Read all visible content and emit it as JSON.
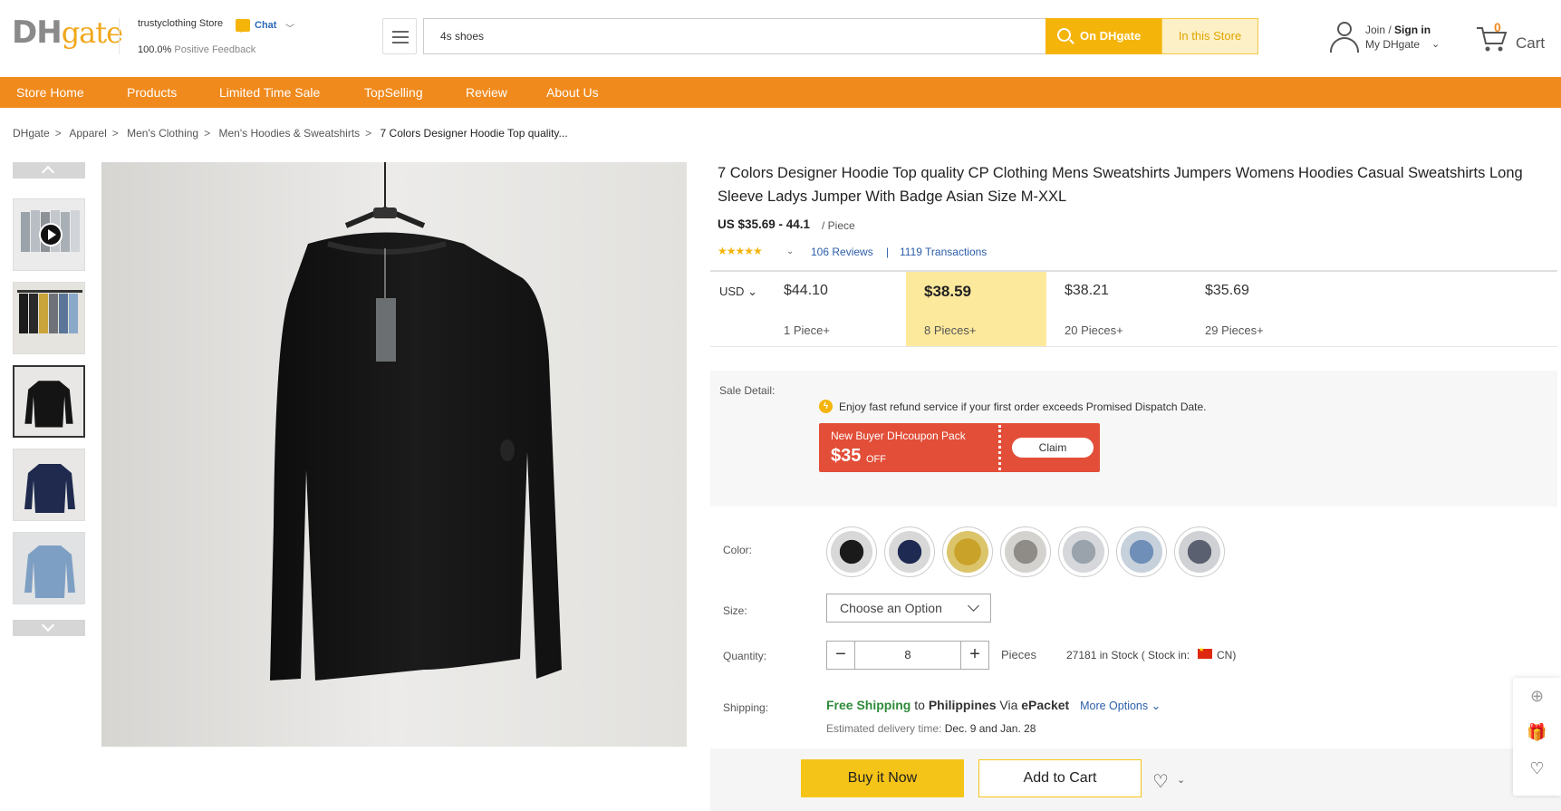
{
  "header": {
    "logo_main": "DH",
    "logo_sub": "gate",
    "store_name": "trustyclothing Store",
    "chat_label": "Chat",
    "feedback_pct": "100.0%",
    "feedback_label": "Positive Feedback",
    "search_value": "4s shoes",
    "search_on_label": "On DHgate",
    "search_store_label": "In this Store",
    "join_label": "Join",
    "signin_label": "Sign in",
    "my_dhgate_label": "My DHgate",
    "cart_count": "0",
    "cart_label": "Cart"
  },
  "nav": {
    "items": [
      "Store Home",
      "Products",
      "Limited Time Sale",
      "TopSelling",
      "Review",
      "About Us"
    ]
  },
  "breadcrumb": [
    "DHgate",
    "Apparel",
    "Men's Clothing",
    "Men's Hoodies & Sweatshirts",
    "7 Colors Designer Hoodie Top quality..."
  ],
  "product": {
    "title": "7 Colors Designer Hoodie Top quality CP Clothing Mens Sweatshirts Jumpers Womens Hoodies Casual Sweatshirts Long Sleeve Ladys Jumper With Badge Asian Size M-XXL",
    "price_range": "US $35.69 - 44.1",
    "price_unit": "/ Piece",
    "rating_stars": "★★★★★",
    "reviews_count": "106",
    "reviews_label": "Reviews",
    "transactions_count": "1119",
    "transactions_label": "Transactions",
    "currency": "USD",
    "tiers": [
      {
        "price": "$44.10",
        "qty": "1 Piece+"
      },
      {
        "price": "$38.59",
        "qty": "8 Pieces+"
      },
      {
        "price": "$38.21",
        "qty": "20 Pieces+"
      },
      {
        "price": "$35.69",
        "qty": "29 Pieces+"
      }
    ],
    "sale_label": "Sale Detail:",
    "refund_text": "Enjoy fast refund service if your first order exceeds Promised Dispatch Date.",
    "coupon": {
      "title": "New Buyer DHcoupon Pack",
      "amount": "$35",
      "off": "OFF",
      "claim": "Claim"
    },
    "color_label": "Color:",
    "size_label": "Size:",
    "size_placeholder": "Choose an Option",
    "quantity_label": "Quantity:",
    "quantity_value": "8",
    "quantity_unit": "Pieces",
    "stock_text": "27181  in Stock ( Stock in:",
    "stock_country": "CN)",
    "shipping_label": "Shipping:",
    "shipping_free": "Free Shipping",
    "shipping_to": "to",
    "shipping_country": "Philippines",
    "shipping_via": "Via",
    "shipping_method": "ePacket",
    "more_options": "More Options",
    "est_label": "Estimated delivery time:",
    "est_dates": "Dec. 9 and Jan. 28",
    "buy_now": "Buy it Now",
    "add_to_cart": "Add to Cart"
  },
  "colors": {
    "brand_orange": "#f08a1c",
    "brand_yellow": "#f5b40a",
    "coupon_red": "#e24e38",
    "tier_highlight": "#fde99c",
    "link_blue": "#2b5ea8",
    "free_green": "#2e8b3a"
  },
  "icons": {
    "menu": "hamburger-icon",
    "search": "search-icon",
    "user": "user-icon",
    "cart": "cart-icon",
    "flag": "china-flag-icon",
    "float": [
      "plus-circle-icon",
      "gift-icon",
      "heart-icon"
    ]
  }
}
